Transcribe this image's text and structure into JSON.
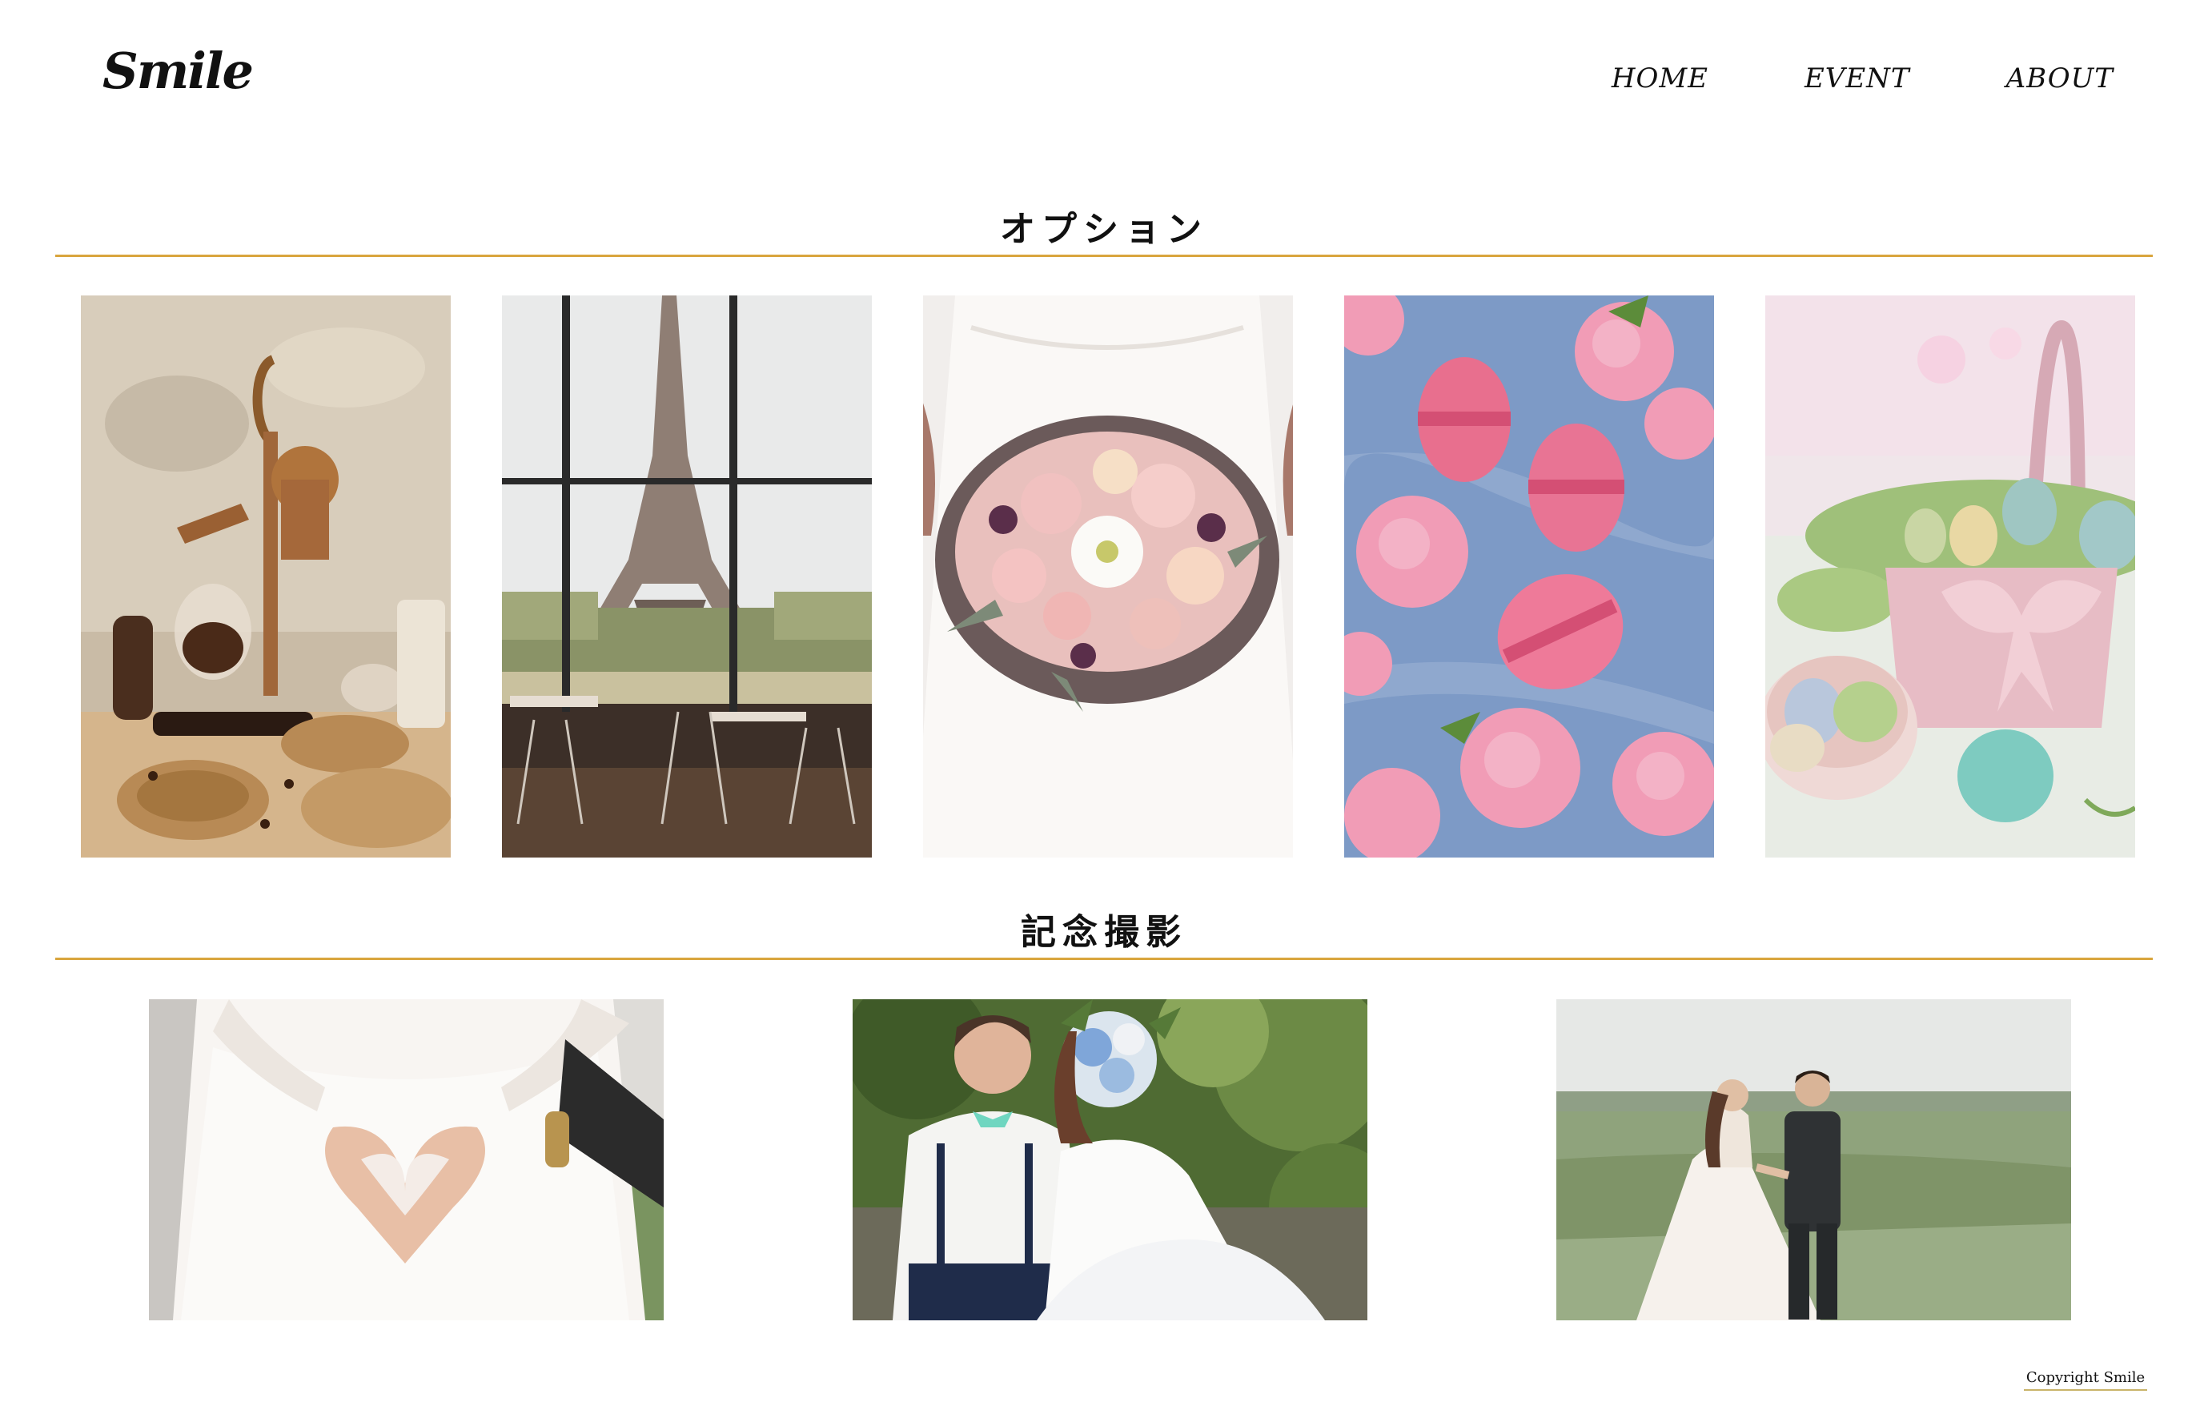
{
  "header": {
    "logo": "Smile",
    "nav": [
      {
        "label": "HOME"
      },
      {
        "label": "EVENT"
      },
      {
        "label": "ABOUT"
      }
    ]
  },
  "sections": {
    "options": {
      "title": "オプション",
      "items": [
        {
          "image": "coffee-siphon-photo"
        },
        {
          "image": "eiffel-tower-cafe-photo"
        },
        {
          "image": "bridal-bouquet-photo"
        },
        {
          "image": "pink-macarons-photo"
        },
        {
          "image": "easter-egg-basket-photo"
        }
      ]
    },
    "photo": {
      "title": "記念撮影",
      "items": [
        {
          "image": "heart-hands-couple-photo"
        },
        {
          "image": "couple-with-bouquet-photo"
        },
        {
          "image": "couple-walking-field-photo"
        }
      ]
    }
  },
  "footer": {
    "copyright": "Copyright Smile"
  },
  "colors": {
    "accent_rule": "#d9a53d",
    "text": "#111111",
    "background": "#ffffff"
  }
}
